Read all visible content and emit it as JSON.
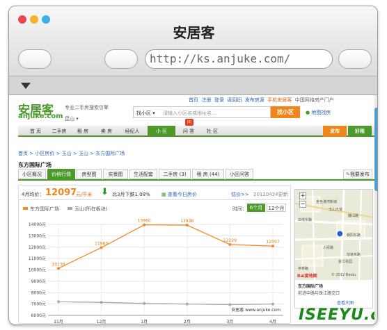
{
  "window": {
    "title": "安居客",
    "url": "http://ks.anjuke.com/",
    "dot_colors": [
      "#e8484a",
      "#f5b02e",
      "#3daee6"
    ]
  },
  "topnav": {
    "links": [
      "首页",
      "注册",
      "登录",
      "返回旧",
      "发布房源",
      "手机安居客",
      "中国网络房产门户"
    ]
  },
  "site": {
    "logo_cn": "安居客",
    "logo_en": "anjuke.com",
    "city": "昆山",
    "tagline": "专业二手房搜索引擎"
  },
  "search": {
    "scope": "找小区",
    "placeholder": "请输入小区名或地址名...",
    "button": "找小区",
    "map_link": "地图找房"
  },
  "nav": {
    "items": [
      "首 页",
      "二手房",
      "租 房",
      "卖 房",
      "经纪人",
      "小 区",
      "问 答",
      "社 区"
    ],
    "selected": "小 区",
    "badge": "问",
    "right": [
      "发布",
      "好租"
    ],
    "accent": "#4b9a2a"
  },
  "breadcrumb": "首页 > 小区房价 > 玉山 > 玉山 > 东方国际广场",
  "community": {
    "name": "东方国际广场"
  },
  "tabs": {
    "items": [
      "小区概况",
      "价格行情",
      "房型图",
      "实景图",
      "生活配套",
      "二手房 (3)",
      "租 房 (44)",
      "小区问答"
    ],
    "selected": "价格行情",
    "right": "我要发布"
  },
  "price": {
    "month_label": "4月均价：",
    "value": "12097",
    "unit": "元/平米",
    "change": "比3月下跌1.08%",
    "link1": "查看今日房价",
    "link2": "估价>>",
    "date": "20120424更新"
  },
  "legend": {
    "items": [
      "东方国际广场",
      "玉山(所在板块)"
    ],
    "time_label": "时间：",
    "ranges": [
      "6个月",
      "12个月"
    ],
    "selected_range": "6个月"
  },
  "chart_data": {
    "type": "line",
    "categories": [
      "11月",
      "12月",
      "1月",
      "2月",
      "3月",
      "4月"
    ],
    "series": [
      {
        "name": "东方国际广场",
        "color": "#f08a24",
        "values": [
          10136,
          11960,
          13960,
          13938,
          12229,
          12097
        ]
      },
      {
        "name": "玉山(所在板块)",
        "color": "#a8a8a8",
        "values": [
          7200,
          7150,
          7050,
          7000,
          6950,
          7000
        ]
      }
    ],
    "ylim": [
      6000,
      14000
    ],
    "yticks": [
      "7000元",
      "8000元",
      "9000元",
      "10000元",
      "11000元",
      "12000元",
      "13000元",
      "14000元",
      "6000元"
    ],
    "data_labels": [
      "10136",
      "11960",
      "13960",
      "13938",
      "12229",
      "12097"
    ],
    "watermark": "安居客 www.anjuke.com",
    "grid": true
  },
  "map": {
    "labels": [
      "金色港湾新城",
      "玉山大道",
      "鹿山路",
      "白塔东路",
      "朝阳东路",
      "人民路",
      "前进东路",
      "亭林路",
      "金江花园"
    ],
    "address_title": "东方国际广场",
    "address": "前进中路与珠江路交口",
    "link": "查看大图",
    "brand": "Bai度地图",
    "copyright": "© 2012 Baidu"
  },
  "watermark": "ISEEYU.com"
}
